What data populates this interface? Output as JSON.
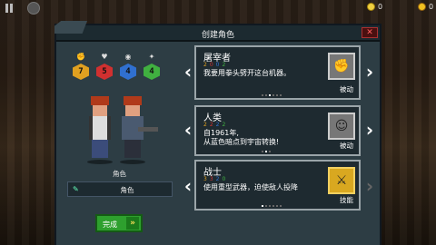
{
  "header": {
    "title": "创建角色",
    "close_label": "✕"
  },
  "currency": {
    "gems": "0",
    "coins": "0"
  },
  "stats": [
    {
      "icon": "fist-icon",
      "value": "7",
      "color": "#e0a020"
    },
    {
      "icon": "heart-icon",
      "value": "5",
      "color": "#d03030"
    },
    {
      "icon": "brain-icon",
      "value": "4",
      "color": "#3070d0"
    },
    {
      "icon": "spirit-icon",
      "value": "4",
      "color": "#40b040"
    }
  ],
  "character": {
    "label": "角色",
    "name_value": "角色"
  },
  "done_button": {
    "label": "完成"
  },
  "slots": [
    {
      "title": "屠宰者",
      "stats": [
        "2",
        "0",
        "0",
        "2"
      ],
      "desc": "我要用拳头劈开这台机器。",
      "sub": "被动"
    },
    {
      "title": "人类",
      "stats": [
        "2",
        "2",
        "2",
        "2"
      ],
      "desc": "自1961年,\n从蓝色暗点到宇宙转换!",
      "sub": "被动"
    },
    {
      "title": "战士",
      "stats": [
        "3",
        "3",
        "2",
        "0"
      ],
      "desc": "使用重型武器，迫使敌人投降",
      "sub": "技能"
    }
  ]
}
